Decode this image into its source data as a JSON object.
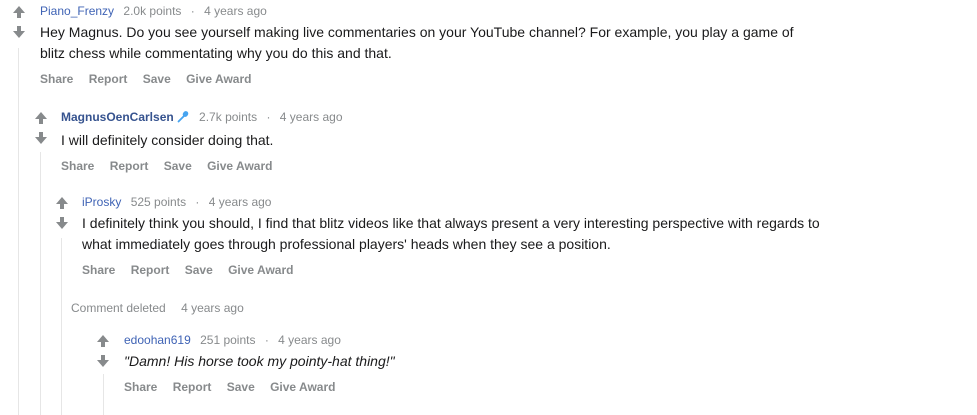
{
  "comments": [
    {
      "author": "Piano_Frenzy",
      "points": "2.0k points",
      "separator": "·",
      "age": "4 years ago",
      "body_line1": "Hey Magnus. Do you see yourself making live commentaries on your YouTube channel? For example, you play a game of",
      "body_line2": "blitz chess while commentating why you do this and that.",
      "actions": [
        "Share",
        "Report",
        "Save",
        "Give Award"
      ]
    },
    {
      "author": "MagnusOenCarlsen",
      "author_icon": "microphone-icon",
      "points": "2.7k points",
      "separator": "·",
      "age": "4 years ago",
      "body_line1": "I will definitely consider doing that.",
      "actions": [
        "Share",
        "Report",
        "Save",
        "Give Award"
      ]
    },
    {
      "author": "iProsky",
      "points": "525 points",
      "separator": "·",
      "age": "4 years ago",
      "body_line1": "I definitely think you should, I find that blitz videos like that always present a very interesting perspective with regards to",
      "body_line2": "what immediately goes through professional players' heads when they see a position.",
      "actions": [
        "Share",
        "Report",
        "Save",
        "Give Award"
      ]
    },
    {
      "deleted_label": "Comment deleted",
      "age": "4 years ago"
    },
    {
      "author": "edoohan619",
      "points": "251 points",
      "separator": "·",
      "age": "4 years ago",
      "body_line1": "\"Damn! His horse took my pointy-hat thing!\"",
      "actions": [
        "Share",
        "Report",
        "Save",
        "Give Award"
      ]
    }
  ],
  "colors": {
    "meta": "#878a8c",
    "author": "#3f63b5",
    "op_author": "#36538f",
    "arrow": "#878a8c",
    "thread_line": "#e6e6e6",
    "mic": "#46a4f0"
  }
}
